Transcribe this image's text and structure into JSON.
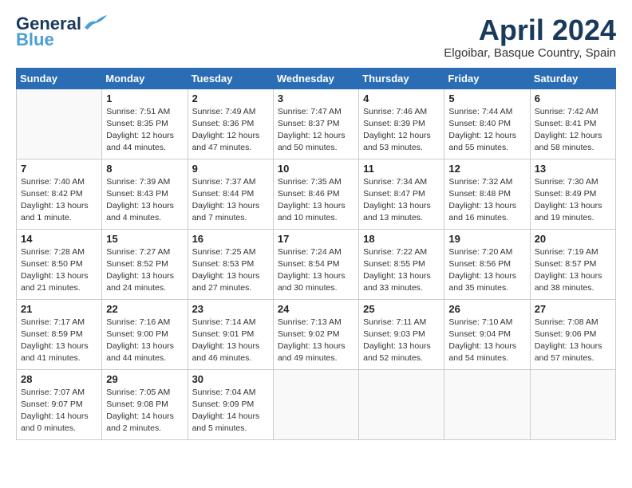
{
  "logo": {
    "line1": "General",
    "line2": "Blue"
  },
  "title": "April 2024",
  "subtitle": "Elgoibar, Basque Country, Spain",
  "days_of_week": [
    "Sunday",
    "Monday",
    "Tuesday",
    "Wednesday",
    "Thursday",
    "Friday",
    "Saturday"
  ],
  "weeks": [
    [
      {
        "num": "",
        "info": ""
      },
      {
        "num": "1",
        "info": "Sunrise: 7:51 AM\nSunset: 8:35 PM\nDaylight: 12 hours\nand 44 minutes."
      },
      {
        "num": "2",
        "info": "Sunrise: 7:49 AM\nSunset: 8:36 PM\nDaylight: 12 hours\nand 47 minutes."
      },
      {
        "num": "3",
        "info": "Sunrise: 7:47 AM\nSunset: 8:37 PM\nDaylight: 12 hours\nand 50 minutes."
      },
      {
        "num": "4",
        "info": "Sunrise: 7:46 AM\nSunset: 8:39 PM\nDaylight: 12 hours\nand 53 minutes."
      },
      {
        "num": "5",
        "info": "Sunrise: 7:44 AM\nSunset: 8:40 PM\nDaylight: 12 hours\nand 55 minutes."
      },
      {
        "num": "6",
        "info": "Sunrise: 7:42 AM\nSunset: 8:41 PM\nDaylight: 12 hours\nand 58 minutes."
      }
    ],
    [
      {
        "num": "7",
        "info": "Sunrise: 7:40 AM\nSunset: 8:42 PM\nDaylight: 13 hours\nand 1 minute."
      },
      {
        "num": "8",
        "info": "Sunrise: 7:39 AM\nSunset: 8:43 PM\nDaylight: 13 hours\nand 4 minutes."
      },
      {
        "num": "9",
        "info": "Sunrise: 7:37 AM\nSunset: 8:44 PM\nDaylight: 13 hours\nand 7 minutes."
      },
      {
        "num": "10",
        "info": "Sunrise: 7:35 AM\nSunset: 8:46 PM\nDaylight: 13 hours\nand 10 minutes."
      },
      {
        "num": "11",
        "info": "Sunrise: 7:34 AM\nSunset: 8:47 PM\nDaylight: 13 hours\nand 13 minutes."
      },
      {
        "num": "12",
        "info": "Sunrise: 7:32 AM\nSunset: 8:48 PM\nDaylight: 13 hours\nand 16 minutes."
      },
      {
        "num": "13",
        "info": "Sunrise: 7:30 AM\nSunset: 8:49 PM\nDaylight: 13 hours\nand 19 minutes."
      }
    ],
    [
      {
        "num": "14",
        "info": "Sunrise: 7:28 AM\nSunset: 8:50 PM\nDaylight: 13 hours\nand 21 minutes."
      },
      {
        "num": "15",
        "info": "Sunrise: 7:27 AM\nSunset: 8:52 PM\nDaylight: 13 hours\nand 24 minutes."
      },
      {
        "num": "16",
        "info": "Sunrise: 7:25 AM\nSunset: 8:53 PM\nDaylight: 13 hours\nand 27 minutes."
      },
      {
        "num": "17",
        "info": "Sunrise: 7:24 AM\nSunset: 8:54 PM\nDaylight: 13 hours\nand 30 minutes."
      },
      {
        "num": "18",
        "info": "Sunrise: 7:22 AM\nSunset: 8:55 PM\nDaylight: 13 hours\nand 33 minutes."
      },
      {
        "num": "19",
        "info": "Sunrise: 7:20 AM\nSunset: 8:56 PM\nDaylight: 13 hours\nand 35 minutes."
      },
      {
        "num": "20",
        "info": "Sunrise: 7:19 AM\nSunset: 8:57 PM\nDaylight: 13 hours\nand 38 minutes."
      }
    ],
    [
      {
        "num": "21",
        "info": "Sunrise: 7:17 AM\nSunset: 8:59 PM\nDaylight: 13 hours\nand 41 minutes."
      },
      {
        "num": "22",
        "info": "Sunrise: 7:16 AM\nSunset: 9:00 PM\nDaylight: 13 hours\nand 44 minutes."
      },
      {
        "num": "23",
        "info": "Sunrise: 7:14 AM\nSunset: 9:01 PM\nDaylight: 13 hours\nand 46 minutes."
      },
      {
        "num": "24",
        "info": "Sunrise: 7:13 AM\nSunset: 9:02 PM\nDaylight: 13 hours\nand 49 minutes."
      },
      {
        "num": "25",
        "info": "Sunrise: 7:11 AM\nSunset: 9:03 PM\nDaylight: 13 hours\nand 52 minutes."
      },
      {
        "num": "26",
        "info": "Sunrise: 7:10 AM\nSunset: 9:04 PM\nDaylight: 13 hours\nand 54 minutes."
      },
      {
        "num": "27",
        "info": "Sunrise: 7:08 AM\nSunset: 9:06 PM\nDaylight: 13 hours\nand 57 minutes."
      }
    ],
    [
      {
        "num": "28",
        "info": "Sunrise: 7:07 AM\nSunset: 9:07 PM\nDaylight: 14 hours\nand 0 minutes."
      },
      {
        "num": "29",
        "info": "Sunrise: 7:05 AM\nSunset: 9:08 PM\nDaylight: 14 hours\nand 2 minutes."
      },
      {
        "num": "30",
        "info": "Sunrise: 7:04 AM\nSunset: 9:09 PM\nDaylight: 14 hours\nand 5 minutes."
      },
      {
        "num": "",
        "info": ""
      },
      {
        "num": "",
        "info": ""
      },
      {
        "num": "",
        "info": ""
      },
      {
        "num": "",
        "info": ""
      }
    ]
  ]
}
